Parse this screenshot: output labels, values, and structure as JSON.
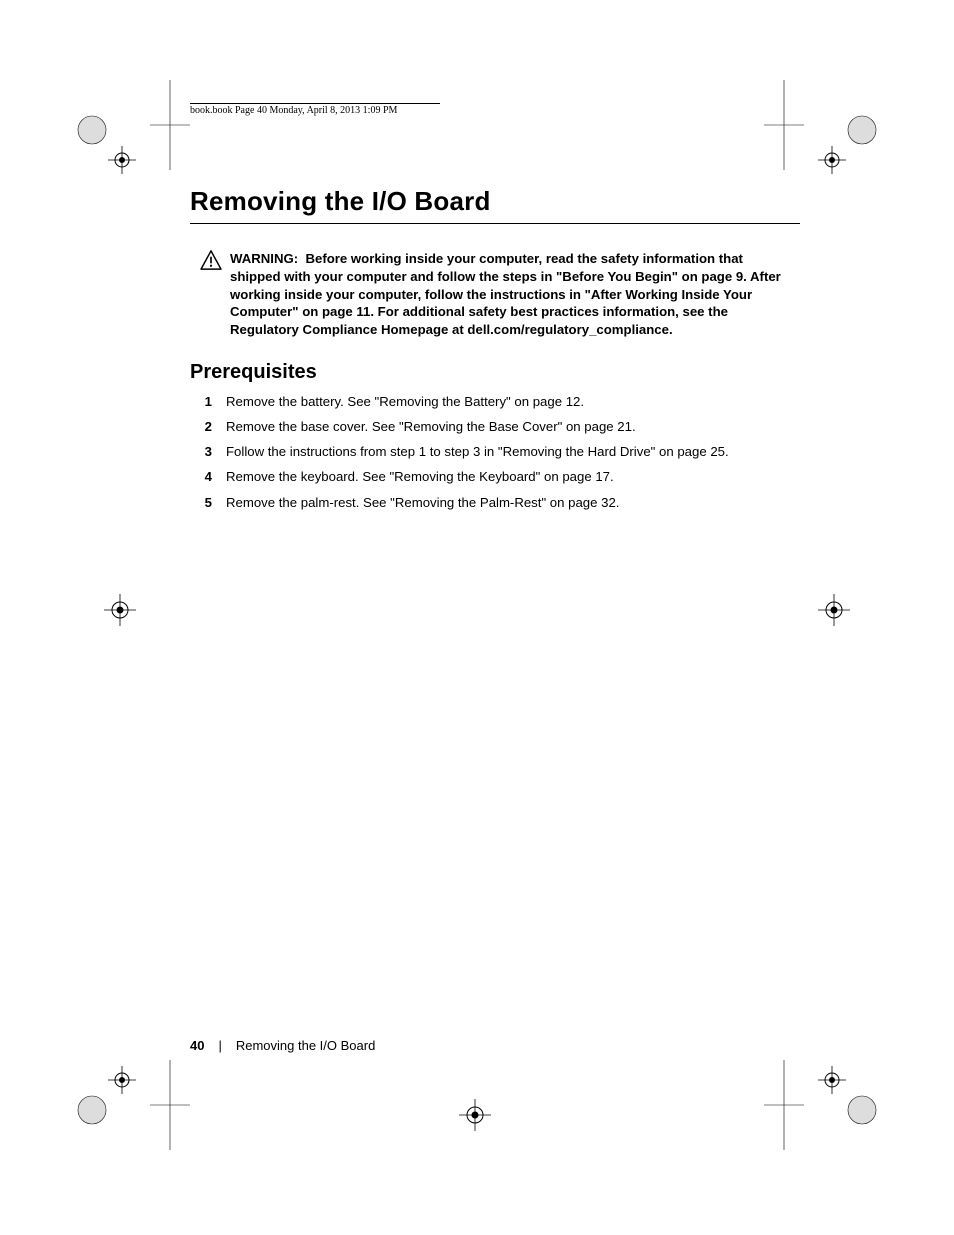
{
  "header": {
    "running": "book.book  Page 40  Monday, April 8, 2013  1:09 PM"
  },
  "title": "Removing the I/O Board",
  "warning": {
    "label": "WARNING:",
    "text": "Before working inside your computer, read the safety information that shipped with your computer and follow the steps in \"Before You Begin\" on page 9. After working inside your computer, follow the instructions in \"After Working Inside Your Computer\" on page 11. For additional safety best practices information, see the Regulatory Compliance Homepage at dell.com/regulatory_compliance."
  },
  "section": "Prerequisites",
  "steps": [
    "Remove the battery. See \"Removing the Battery\" on page 12.",
    "Remove the base cover. See \"Removing the Base Cover\" on page 21.",
    "Follow the instructions from step 1 to step 3 in \"Removing the Hard Drive\" on page 25.",
    "Remove the keyboard. See \"Removing the Keyboard\" on page 17.",
    "Remove the palm-rest. See \"Removing the Palm-Rest\" on page 32."
  ],
  "footer": {
    "page": "40",
    "separator": "|",
    "title": "Removing the I/O Board"
  }
}
